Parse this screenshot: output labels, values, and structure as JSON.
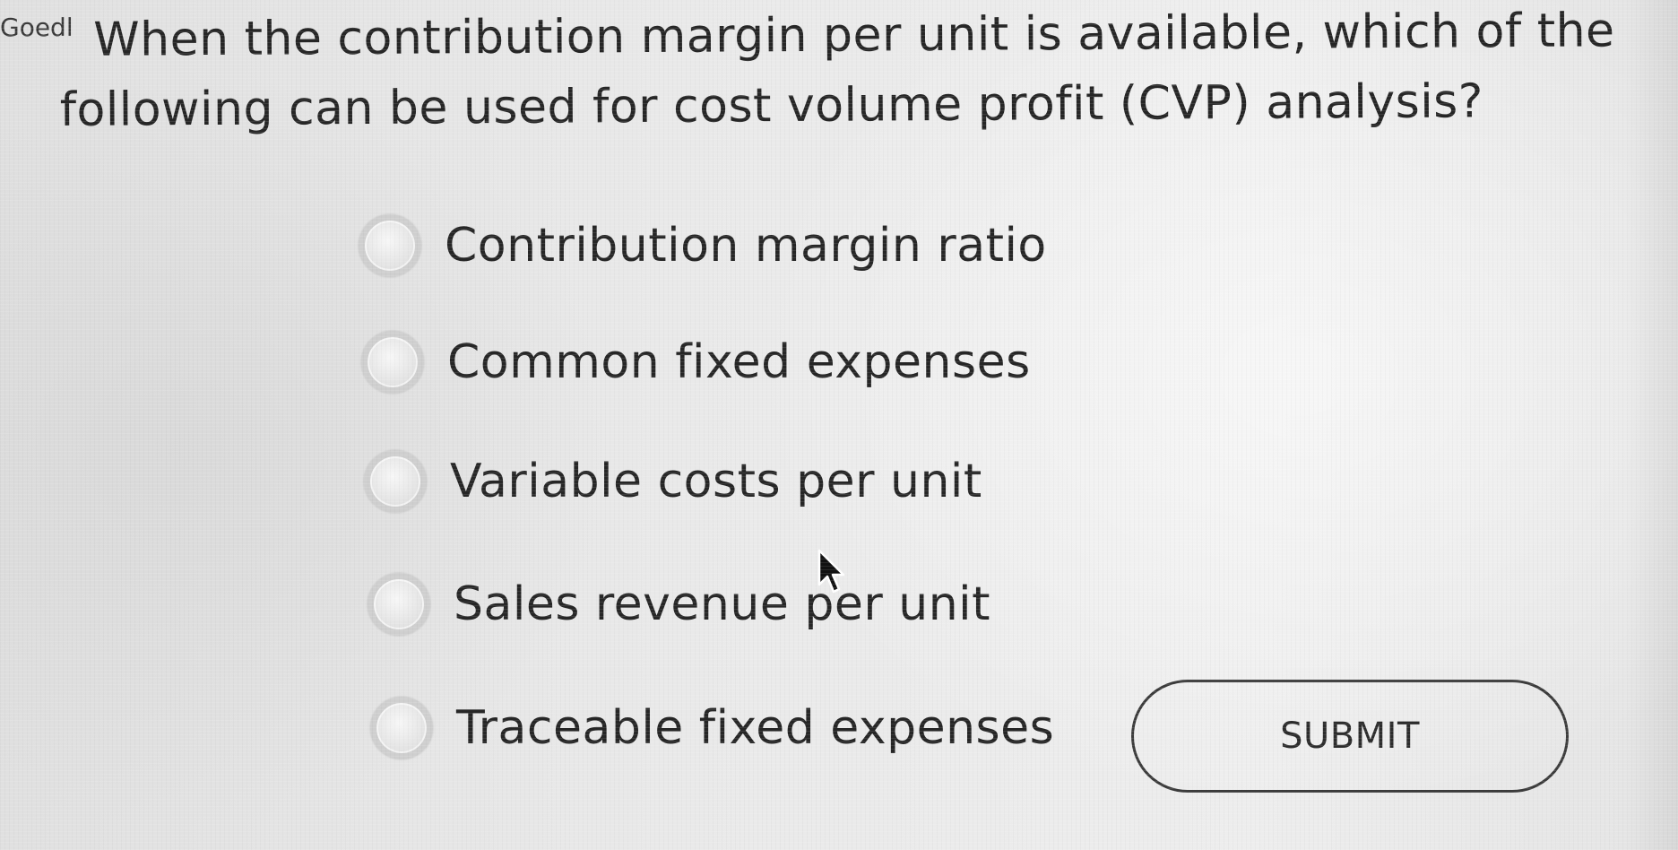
{
  "question_prefix": "Goedl",
  "question": {
    "line1": "When the contribution margin per unit is available, which of the",
    "line2": "following can be used for cost volume profit (CVP) analysis?"
  },
  "options": [
    {
      "label": "Contribution margin ratio"
    },
    {
      "label": "Common fixed expenses"
    },
    {
      "label": "Variable costs per unit"
    },
    {
      "label": "Sales revenue per unit"
    },
    {
      "label": "Traceable fixed expenses"
    }
  ],
  "submit_label": "SUBMIT",
  "selected_option": null,
  "icons": {
    "radio": "radio-button-empty",
    "cursor": "mouse-pointer-icon"
  }
}
